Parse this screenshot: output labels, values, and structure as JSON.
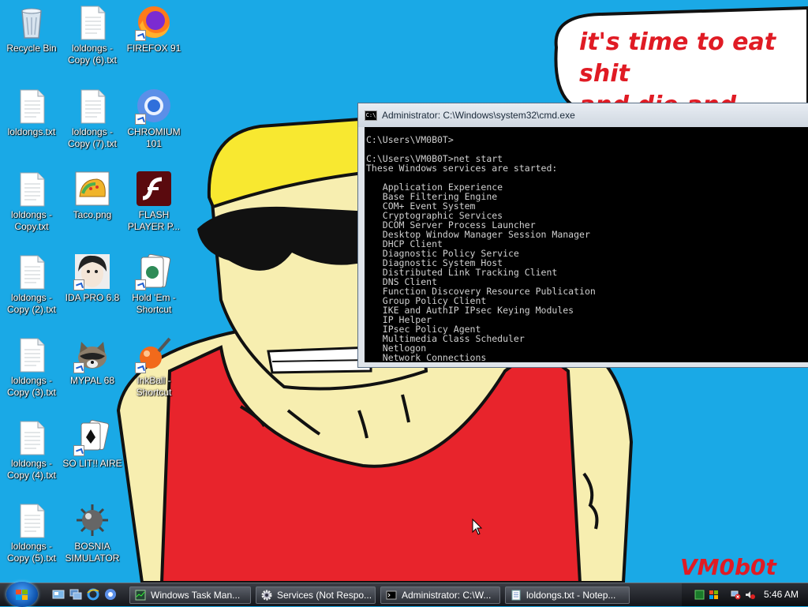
{
  "desktop": {
    "icons": [
      {
        "label": "Recycle Bin",
        "kind": "recycle-bin"
      },
      {
        "label": "loldongs - Copy (6).txt",
        "kind": "text-file"
      },
      {
        "label": "FIREFOX 91",
        "kind": "firefox"
      },
      {
        "label": "loldongs.txt",
        "kind": "text-file"
      },
      {
        "label": "loldongs - Copy (7).txt",
        "kind": "text-file"
      },
      {
        "label": "CHROMIUM 101",
        "kind": "chromium"
      },
      {
        "label": "loldongs - Copy.txt",
        "kind": "text-file"
      },
      {
        "label": "Taco.png",
        "kind": "image-file"
      },
      {
        "label": "FLASH PLAYER P...",
        "kind": "flash"
      },
      {
        "label": "loldongs - Copy (2).txt",
        "kind": "text-file"
      },
      {
        "label": "IDA PRO 6.8",
        "kind": "ida"
      },
      {
        "label": "Hold 'Em - Shortcut",
        "kind": "cards"
      },
      {
        "label": "loldongs - Copy (3).txt",
        "kind": "text-file"
      },
      {
        "label": "MYPAL 68",
        "kind": "raccoon"
      },
      {
        "label": "InkBall - Shortcut",
        "kind": "inkball"
      },
      {
        "label": "loldongs - Copy (4).txt",
        "kind": "text-file"
      },
      {
        "label": "SO LIT!! AIRE",
        "kind": "solitaire"
      },
      {
        "label": "loldongs - Copy (5).txt",
        "kind": "text-file"
      },
      {
        "label": "BOSNIA SIMULATOR",
        "kind": "mine"
      }
    ]
  },
  "wallpaper": {
    "speech_bubble": "it's time to eat shit\nand die and chew\nbubble gum",
    "signature": "VM0b0t"
  },
  "cmd_window": {
    "title": "Administrator: C:\\Windows\\system32\\cmd.exe",
    "lines": [
      "C:\\Users\\VM0B0T>",
      "",
      "C:\\Users\\VM0B0T>net start",
      "These Windows services are started:",
      "",
      "   Application Experience",
      "   Base Filtering Engine",
      "   COM+ Event System",
      "   Cryptographic Services",
      "   DCOM Server Process Launcher",
      "   Desktop Window Manager Session Manager",
      "   DHCP Client",
      "   Diagnostic Policy Service",
      "   Diagnostic System Host",
      "   Distributed Link Tracking Client",
      "   DNS Client",
      "   Function Discovery Resource Publication",
      "   Group Policy Client",
      "   IKE and AuthIP IPsec Keying Modules",
      "   IP Helper",
      "   IPsec Policy Agent",
      "   Multimedia Class Scheduler",
      "   Netlogon",
      "   Network Connections"
    ]
  },
  "taskbar": {
    "tasks": [
      {
        "label": "Windows Task Man...",
        "icon": "task-manager-icon"
      },
      {
        "label": "Services (Not Respo...",
        "icon": "services-gear-icon"
      },
      {
        "label": "Administrator: C:\\W...",
        "icon": "cmd-icon"
      },
      {
        "label": "loldongs.txt - Notep...",
        "icon": "notepad-icon"
      }
    ],
    "clock": "5:46 AM"
  },
  "colors": {
    "sky": "#1aa9e6",
    "skin": "#f7eeb0",
    "shirt": "#e8242c",
    "hat": "#f8e830",
    "text_red": "#e01b24"
  }
}
